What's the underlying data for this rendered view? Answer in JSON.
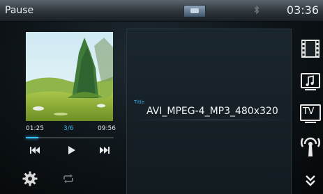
{
  "status_bar": {
    "title": "Pause",
    "clock": "03:36",
    "source_icon": "source-icon",
    "bluetooth_icon": "bluetooth-icon"
  },
  "player": {
    "album_art": "album-art-landscape",
    "elapsed": "01:25",
    "track_counter": "3/6",
    "total": "09:56",
    "progress_fraction": 0.145,
    "controls": {
      "prev_icon": "skip-back-icon",
      "play_icon": "play-icon",
      "next_icon": "skip-forward-icon"
    },
    "settings_icon": "gear-icon",
    "repeat_icon": "repeat-icon"
  },
  "info": {
    "title_label": "Title",
    "title_value": "AVI_MPEG-4_MP3_480x320"
  },
  "side_menu": {
    "items": [
      {
        "name": "video",
        "icon": "film-icon"
      },
      {
        "name": "music",
        "icon": "music-note-icon"
      },
      {
        "name": "tv",
        "icon": "tv-icon",
        "label": "TV"
      },
      {
        "name": "radio",
        "icon": "radio-antenna-icon"
      },
      {
        "name": "more",
        "icon": "double-chevron-down-icon"
      }
    ]
  },
  "colors": {
    "accent": "#35c3f5",
    "label_blue": "#39a9e2",
    "panel": "#121b20"
  }
}
